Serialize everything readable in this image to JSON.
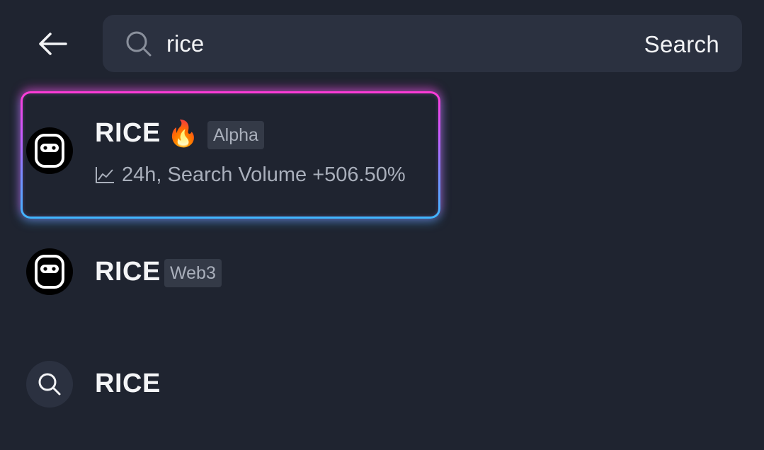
{
  "search": {
    "query": "rice",
    "submit_label": "Search"
  },
  "results": [
    {
      "name": "RICE",
      "hot_emoji": "🔥",
      "tag": "Alpha",
      "trend_text": "24h, Search Volume +506.50%",
      "highlighted": true
    },
    {
      "name": "RICE",
      "tag": "Web3"
    },
    {
      "name": "RICE",
      "type": "search-suggestion"
    }
  ],
  "icons": {
    "back": "arrow-left-icon",
    "search": "search-icon",
    "token_logo": "robot-face-icon",
    "trend": "line-chart-icon",
    "hot": "fire-icon"
  },
  "colors": {
    "background": "#1f2430",
    "surface": "#2b3140",
    "tag_bg": "#343a47",
    "text_primary": "#f2f3f5",
    "text_secondary": "#a9afbb",
    "glow_top": "#ff3ad6",
    "glow_bottom": "#3fb6ff"
  }
}
